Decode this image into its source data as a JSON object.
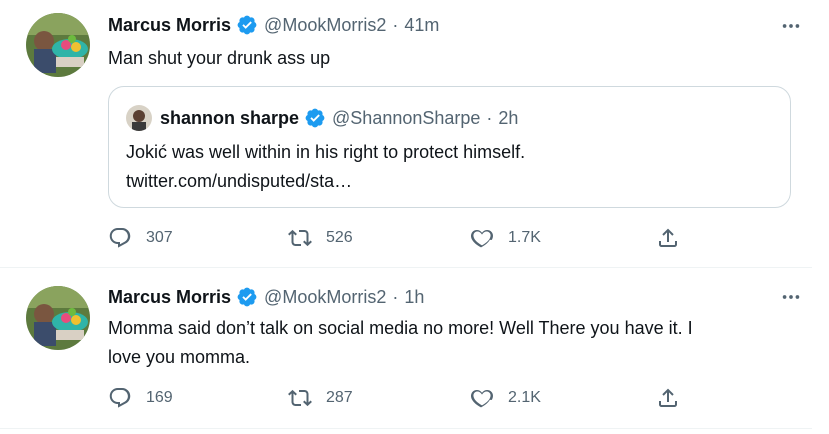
{
  "tweets": [
    {
      "author": {
        "name": "Marcus Morris",
        "handle": "@MookMorris2",
        "verified": true
      },
      "time": "41m",
      "text": "Man shut your drunk ass up",
      "quote": {
        "author": {
          "name": "shannon sharpe",
          "handle": "@ShannonSharpe",
          "verified": true
        },
        "time": "2h",
        "text_line1": "Jokić was well within in his right to protect himself.",
        "text_line2": "twitter.com/undisputed/sta…"
      },
      "stats": {
        "replies": "307",
        "retweets": "526",
        "likes": "1.7K"
      }
    },
    {
      "author": {
        "name": "Marcus Morris",
        "handle": "@MookMorris2",
        "verified": true
      },
      "time": "1h",
      "text_line1": "Momma said don’t talk on social media no more! Well There you have it. I",
      "text_line2": "love you momma.",
      "stats": {
        "replies": "169",
        "retweets": "287",
        "likes": "2.1K"
      }
    }
  ],
  "separator": "·",
  "icons": {
    "verified": "verified-badge-icon",
    "more": "more-dots-icon",
    "reply": "reply-icon",
    "retweet": "retweet-icon",
    "like": "heart-icon",
    "share": "share-icon"
  },
  "colors": {
    "verified": "#1d9bf0",
    "text": "#0f1419",
    "secondary": "#536471",
    "border": "#cfd9de"
  }
}
